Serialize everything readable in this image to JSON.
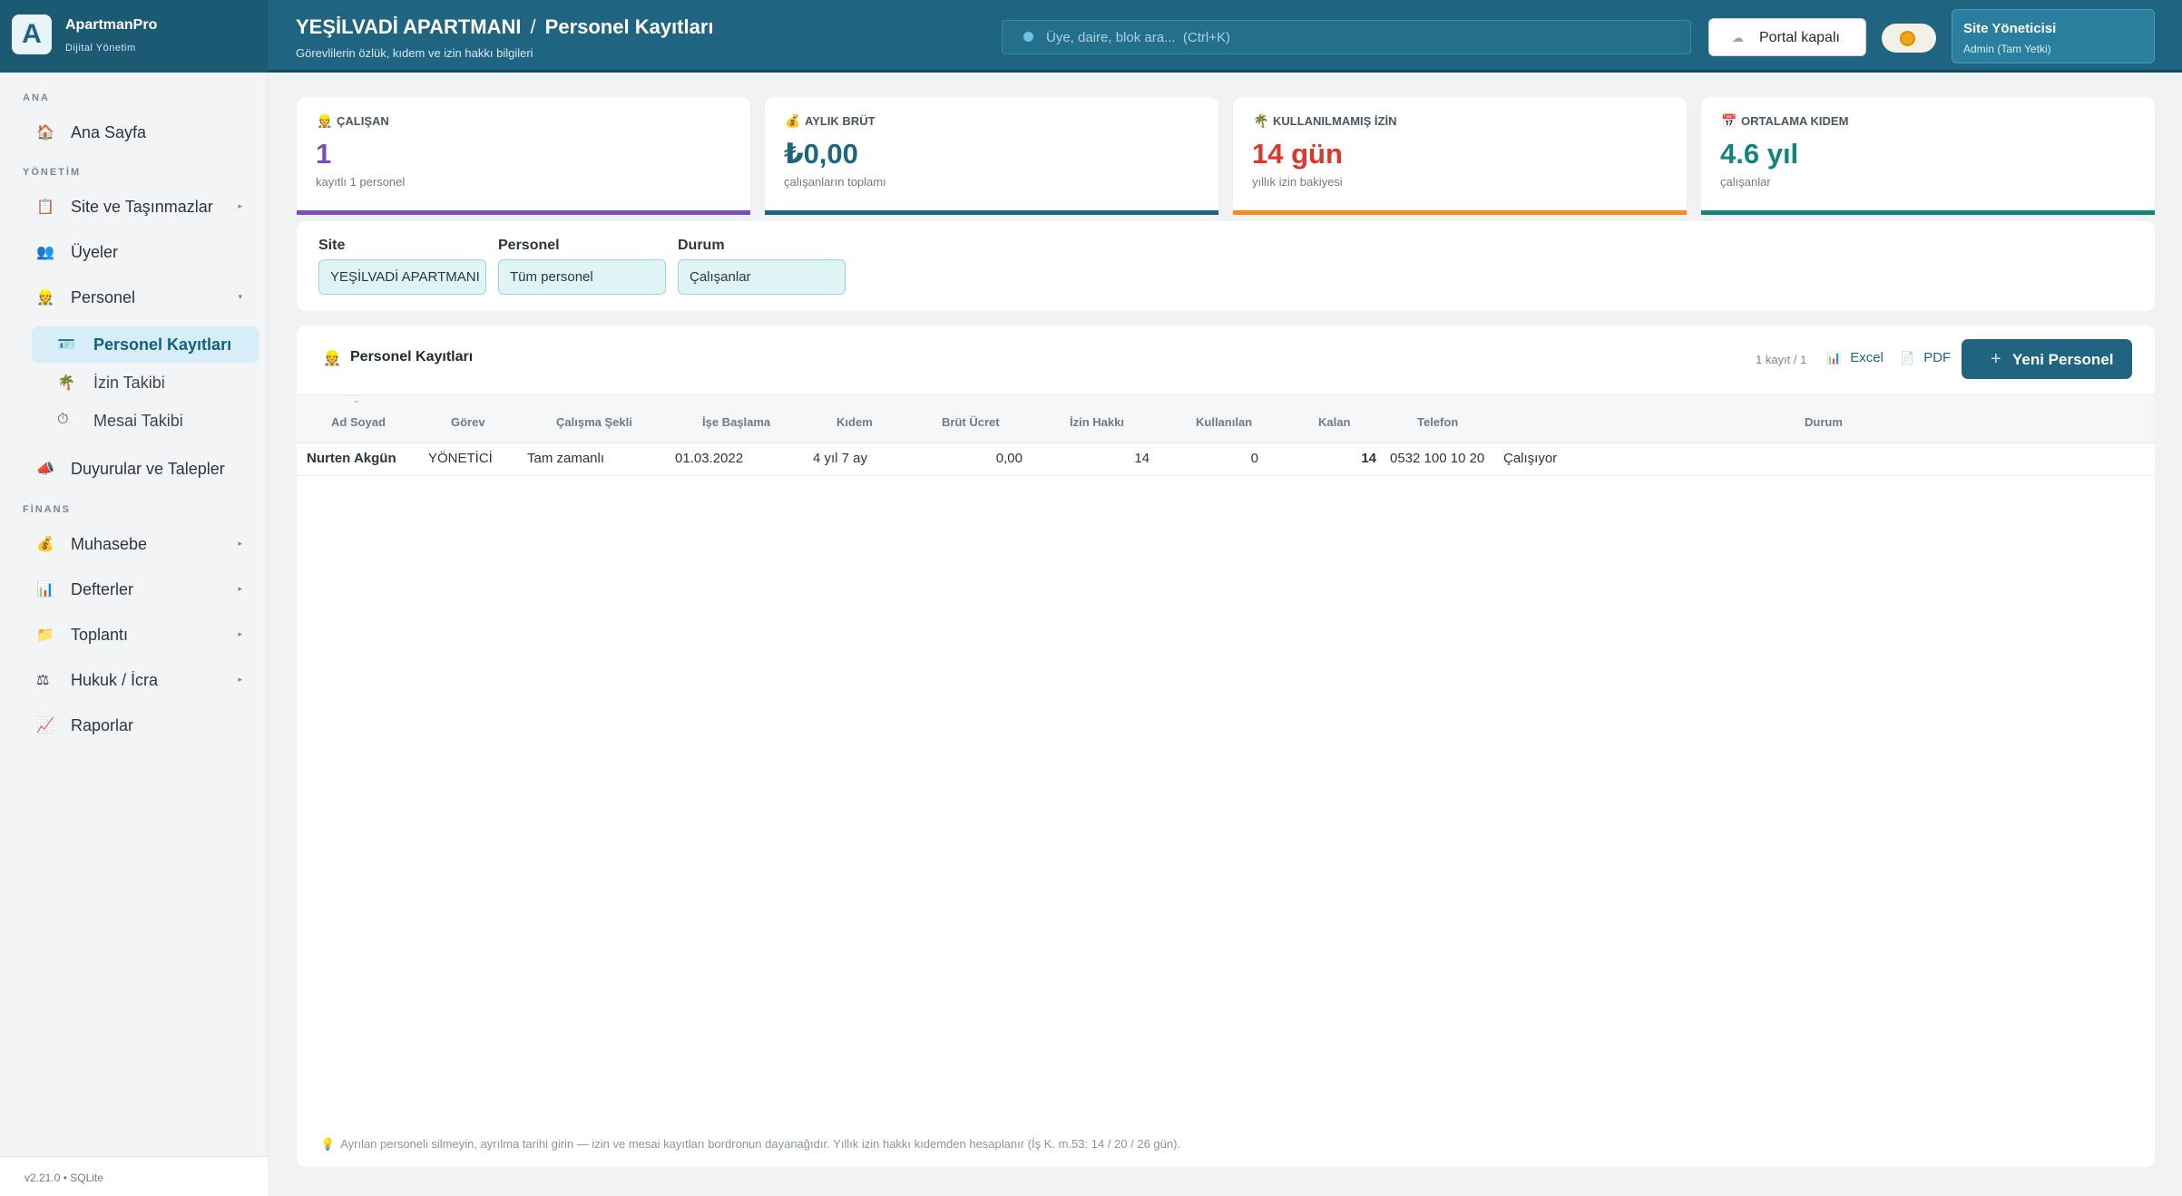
{
  "brand": {
    "logo_letter": "A",
    "name": "ApartmanPro",
    "subtitle": "Dijital Yönetim"
  },
  "header": {
    "site_name": "YEŞİLVADİ APARTMANI",
    "separator": "/",
    "page_title": "Personel Kayıtları",
    "page_subtitle": "Görevlilerin özlük, kıdem ve izin hakkı bilgileri",
    "search_placeholder": "Üye, daire, blok ara...  (Ctrl+K)",
    "portal_label": "Portal kapalı",
    "user_name": "Site Yöneticisi",
    "user_role": "Admin (Tam Yetki)"
  },
  "sidebar": {
    "sections": {
      "ana": "ANA",
      "yonetim": "YÖNETİM",
      "finans": "FİNANS"
    },
    "items": {
      "home": "Ana Sayfa",
      "site": "Site ve Taşınmazlar",
      "members": "Üyeler",
      "staff": "Personel",
      "staff_records": "Personel Kayıtları",
      "leave": "İzin Takibi",
      "overtime": "Mesai Takibi",
      "announcements": "Duyurular ve Talepler",
      "accounting": "Muhasebe",
      "ledgers": "Defterler",
      "meeting": "Toplantı",
      "legal": "Hukuk / İcra",
      "reports": "Raporlar"
    },
    "icons": {
      "home": "🏠",
      "site": "📋",
      "members": "👥",
      "staff": "👷",
      "staff_records": "🪪",
      "leave": "🌴",
      "overtime": "⏱",
      "announcements": "📣",
      "accounting": "💰",
      "ledgers": "📊",
      "meeting": "📁",
      "legal": "⚖",
      "reports": "📈"
    },
    "arrow": "▸",
    "arrow_down": "▾",
    "version": "v2.21.0  •  SQLite"
  },
  "kpis": [
    {
      "icon": "👷",
      "label": "ÇALIŞAN",
      "value": "1",
      "sub": "kayıtlı 1 personel",
      "color": "#7c4dbd"
    },
    {
      "icon": "💰",
      "label": "AYLIK BRÜT",
      "value": "₺0,00",
      "sub": "çalışanların toplamı",
      "color": "#1c6680"
    },
    {
      "icon": "🌴",
      "label": "KULLANILMAMIŞ İZİN",
      "value": "14 gün",
      "sub": "yıllık izin bakiyesi",
      "color": "#e0352b",
      "bar_color": "#f28c1e"
    },
    {
      "icon": "📅",
      "label": "ORTALAMA KIDEM",
      "value": "4.6 yıl",
      "sub": "çalışanlar",
      "color": "#12857a"
    }
  ],
  "filters": {
    "site_label": "Site",
    "site_value": "YEŞİLVADİ APARTMANI",
    "staff_label": "Personel",
    "staff_value": "Tüm personel",
    "status_label": "Durum",
    "status_value": "Çalışanlar"
  },
  "records": {
    "icon": "👷",
    "title": "Personel Kayıtları",
    "count": "1 kayıt / 1",
    "excel_label": "Excel",
    "pdf_label": "PDF",
    "new_label": "Yeni Personel",
    "new_icon": "+",
    "sort_icon": "⌄",
    "columns": {
      "name": "Ad Soyad",
      "role": "Görev",
      "work_type": "Çalışma Şekli",
      "start": "İşe Başlama",
      "seniority": "Kıdem",
      "gross": "Brüt Ücret",
      "leave_right": "İzin Hakkı",
      "used": "Kullanılan",
      "remaining": "Kalan",
      "phone": "Telefon",
      "status": "Durum"
    },
    "rows": [
      {
        "name": "Nurten Akgün",
        "role": "YÖNETİCİ",
        "work_type": "Tam zamanlı",
        "start": "01.03.2022",
        "seniority": "4 yıl 7 ay",
        "gross": "0,00",
        "leave_right": "14",
        "used": "0",
        "remaining": "14",
        "phone": "0532 100 10 20",
        "status": "Çalışıyor"
      }
    ],
    "footnote_icon": "💡",
    "footnote": "Ayrılan personeli silmeyin, ayrılma tarihi girin — izin ve mesai kayıtları bordronun dayanağıdır. Yıllık izin hakkı kıdemden hesaplanır (İş K. m.53: 14 / 20 / 26 gün)."
  }
}
